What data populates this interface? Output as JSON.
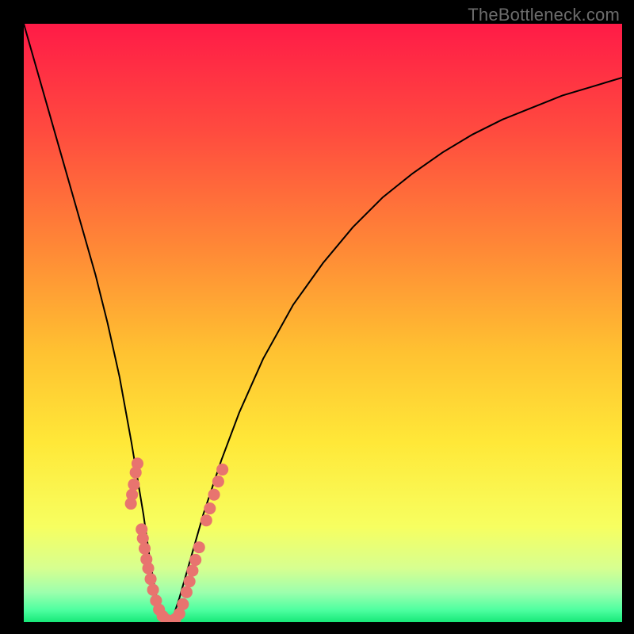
{
  "watermark": "TheBottleneck.com",
  "colors": {
    "frame": "#000000",
    "curve": "#000000",
    "dot": "#e8746f",
    "gradient_stops": [
      {
        "pct": 0,
        "color": "#ff1b47"
      },
      {
        "pct": 18,
        "color": "#ff4b3f"
      },
      {
        "pct": 38,
        "color": "#ff8a36"
      },
      {
        "pct": 55,
        "color": "#ffc231"
      },
      {
        "pct": 70,
        "color": "#ffe838"
      },
      {
        "pct": 84,
        "color": "#f7ff60"
      },
      {
        "pct": 91,
        "color": "#d7ff90"
      },
      {
        "pct": 95,
        "color": "#9dffad"
      },
      {
        "pct": 98,
        "color": "#4dffa0"
      },
      {
        "pct": 100,
        "color": "#17e878"
      }
    ]
  },
  "chart_data": {
    "type": "line",
    "title": "",
    "xlabel": "",
    "ylabel": "",
    "xlim": [
      0,
      100
    ],
    "ylim": [
      0,
      100
    ],
    "series": [
      {
        "name": "bottleneck-curve",
        "x": [
          0,
          2,
          4,
          6,
          8,
          10,
          12,
          14,
          16,
          18,
          19,
          20,
          21,
          22,
          23,
          24,
          25,
          26,
          28,
          30,
          33,
          36,
          40,
          45,
          50,
          55,
          60,
          65,
          70,
          75,
          80,
          85,
          90,
          95,
          100
        ],
        "y": [
          100,
          93,
          86,
          79,
          72,
          65,
          58,
          50,
          41,
          30,
          24,
          18,
          11,
          5,
          1,
          0,
          1,
          4,
          11,
          18,
          27,
          35,
          44,
          53,
          60,
          66,
          71,
          75,
          78.5,
          81.5,
          84,
          86,
          88,
          89.5,
          91
        ]
      }
    ],
    "dot_clusters": [
      {
        "name": "left-arm-dots",
        "points": [
          {
            "x": 19.0,
            "y": 26.5
          },
          {
            "x": 18.7,
            "y": 25.0
          },
          {
            "x": 18.4,
            "y": 23.0
          },
          {
            "x": 18.1,
            "y": 21.3
          },
          {
            "x": 17.9,
            "y": 19.8
          },
          {
            "x": 19.7,
            "y": 15.5
          },
          {
            "x": 19.9,
            "y": 14.0
          },
          {
            "x": 20.2,
            "y": 12.3
          },
          {
            "x": 20.5,
            "y": 10.5
          },
          {
            "x": 20.8,
            "y": 9.0
          },
          {
            "x": 21.2,
            "y": 7.2
          },
          {
            "x": 21.6,
            "y": 5.4
          },
          {
            "x": 22.1,
            "y": 3.6
          },
          {
            "x": 22.6,
            "y": 2.1
          },
          {
            "x": 23.2,
            "y": 1.0
          }
        ]
      },
      {
        "name": "bottom-dots",
        "points": [
          {
            "x": 23.8,
            "y": 0.4
          },
          {
            "x": 24.5,
            "y": 0.2
          },
          {
            "x": 25.3,
            "y": 0.5
          },
          {
            "x": 26.0,
            "y": 1.4
          }
        ]
      },
      {
        "name": "right-arm-dots",
        "points": [
          {
            "x": 26.6,
            "y": 3.0
          },
          {
            "x": 27.2,
            "y": 5.0
          },
          {
            "x": 27.7,
            "y": 6.8
          },
          {
            "x": 28.2,
            "y": 8.6
          },
          {
            "x": 28.7,
            "y": 10.4
          },
          {
            "x": 29.3,
            "y": 12.5
          },
          {
            "x": 30.5,
            "y": 17.0
          },
          {
            "x": 31.1,
            "y": 19.0
          },
          {
            "x": 31.8,
            "y": 21.3
          },
          {
            "x": 32.5,
            "y": 23.5
          },
          {
            "x": 33.2,
            "y": 25.5
          }
        ]
      }
    ]
  }
}
